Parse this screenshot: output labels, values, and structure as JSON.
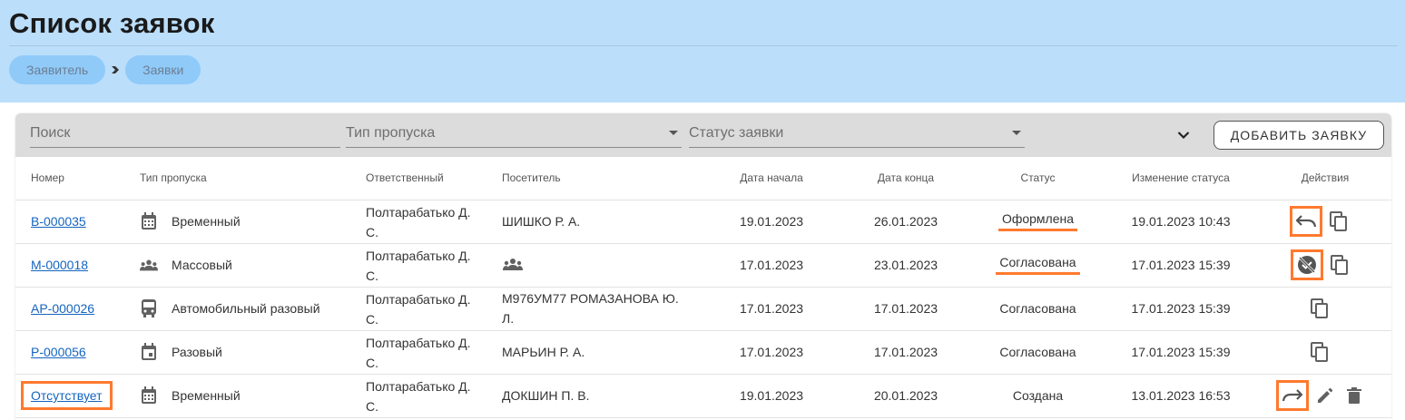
{
  "page": {
    "title": "Список заявок"
  },
  "breadcrumb": [
    {
      "label": "Заявитель"
    },
    {
      "label": "Заявки"
    }
  ],
  "toolbar": {
    "search_placeholder": "Поиск",
    "pass_type_placeholder": "Тип пропуска",
    "status_placeholder": "Статус заявки",
    "add_button": "ДОБАВИТЬ ЗАЯВКУ"
  },
  "table": {
    "headers": {
      "number": "Номер",
      "pass_type": "Тип пропуска",
      "responsible": "Ответственный",
      "visitor": "Посетитель",
      "start_date": "Дата начала",
      "end_date": "Дата конца",
      "status": "Статус",
      "status_changed": "Изменение статуса",
      "actions": "Действия"
    },
    "rows": [
      {
        "number": "В-000035",
        "type_icon": "calendar-icon",
        "pass_type": "Временный",
        "responsible_1": "Полтарабатько Д.",
        "responsible_2": "С.",
        "visitor_1": "ШИШКО Р. А.",
        "visitor_2": "",
        "start": "19.01.2023",
        "end": "26.01.2023",
        "status": "Оформлена",
        "status_changed": "19.01.2023 10:43",
        "actions": [
          "undo-icon",
          "copy-icon"
        ]
      },
      {
        "number": "М-000018",
        "type_icon": "group-icon",
        "pass_type": "Массовый",
        "responsible_1": "Полтарабатько Д.",
        "responsible_2": "С.",
        "visitor_1": "",
        "visitor_2": "",
        "start": "17.01.2023",
        "end": "23.01.2023",
        "status": "Согласована",
        "status_changed": "17.01.2023 15:39",
        "actions": [
          "cancel-icon",
          "copy-icon"
        ]
      },
      {
        "number": "АР-000026",
        "type_icon": "bus-icon",
        "pass_type": "Автомобильный разовый",
        "responsible_1": "Полтарабатько Д.",
        "responsible_2": "С.",
        "visitor_1": "М976УМ77 РОМАЗАНОВА Ю.",
        "visitor_2": "Л.",
        "start": "17.01.2023",
        "end": "17.01.2023",
        "status": "Согласована",
        "status_changed": "17.01.2023 15:39",
        "actions": [
          "copy-icon"
        ]
      },
      {
        "number": "Р-000056",
        "type_icon": "event-icon",
        "pass_type": "Разовый",
        "responsible_1": "Полтарабатько Д.",
        "responsible_2": "С.",
        "visitor_1": "МАРЬИН Р. А.",
        "visitor_2": "",
        "start": "17.01.2023",
        "end": "17.01.2023",
        "status": "Согласована",
        "status_changed": "17.01.2023 15:39",
        "actions": [
          "copy-icon"
        ]
      },
      {
        "number": "Отсутствует",
        "type_icon": "calendar-icon",
        "pass_type": "Временный",
        "responsible_1": "Полтарабатько Д.",
        "responsible_2": "С.",
        "visitor_1": "ДОКШИН П. В.",
        "visitor_2": "",
        "start": "19.01.2023",
        "end": "20.01.2023",
        "status": "Создана",
        "status_changed": "13.01.2023 16:53",
        "actions": [
          "redo-icon",
          "edit-icon",
          "delete-icon"
        ]
      }
    ]
  },
  "colors": {
    "header_bg": "#bbdefb",
    "breadcrumb_bg": "#90caf9",
    "toolbar_bg": "#dcdcdc",
    "link": "#1565c0",
    "highlight": "#ff7a2e"
  }
}
